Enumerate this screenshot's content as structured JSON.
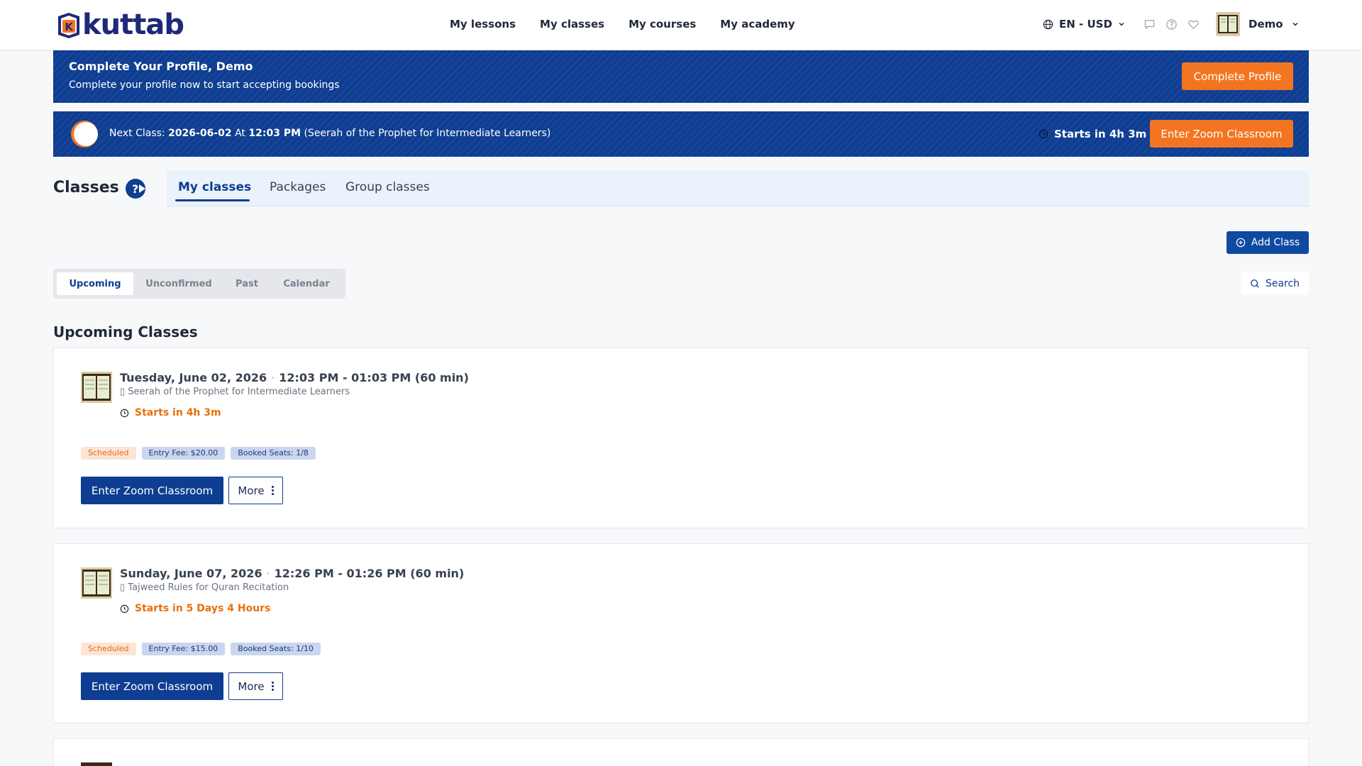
{
  "nav": {
    "logo_text": "kuttab",
    "links": [
      {
        "label": "My lessons"
      },
      {
        "label": "My classes"
      },
      {
        "label": "My courses"
      },
      {
        "label": "My academy"
      }
    ],
    "lang_currency": "EN - USD",
    "user_name": "Demo",
    "icons": [
      "chat-icon",
      "help-icon",
      "heart-icon"
    ]
  },
  "profile_banner": {
    "title": "Complete Your Profile, Demo",
    "subtitle": "Complete your profile now to start accepting bookings",
    "button": "Complete Profile"
  },
  "next_class_banner": {
    "prefix": "Next Class:",
    "date": "2026-06-02",
    "at": "At",
    "time": "12:03 PM",
    "course": "(Seerah of the Prophet for Intermediate Learners)",
    "starts_in": "Starts in 4h 3m",
    "button": "Enter Zoom Classroom"
  },
  "page": {
    "title": "Classes",
    "tabs": [
      {
        "label": "My classes",
        "active": true
      },
      {
        "label": "Packages",
        "active": false
      },
      {
        "label": "Group classes",
        "active": false
      }
    ],
    "add_button": "Add Class",
    "filters": [
      {
        "label": "Upcoming",
        "active": true
      },
      {
        "label": "Unconfirmed",
        "active": false
      },
      {
        "label": "Past",
        "active": false
      },
      {
        "label": "Calendar",
        "active": false
      }
    ],
    "search_button": "Search",
    "section_title": "Upcoming Classes"
  },
  "classes": [
    {
      "date": "Tuesday, June 02, 2026",
      "time": "12:03 PM - 01:03 PM (60 min)",
      "course": "Seerah of the Prophet for Intermediate Learners",
      "starts_in": "Starts in 4h 3m",
      "status": "Scheduled",
      "entry_fee": "Entry Fee: $20.00",
      "booked_seats": "Booked Seats: 1/8",
      "enter_button": "Enter Zoom Classroom",
      "more_button": "More"
    },
    {
      "date": "Sunday, June 07, 2026",
      "time": "12:26 PM - 01:26 PM (60 min)",
      "course": "Tajweed Rules for Quran Recitation",
      "starts_in": "Starts in 5 Days 4 Hours",
      "status": "Scheduled",
      "entry_fee": "Entry Fee: $15.00",
      "booked_seats": "Booked Seats: 1/10",
      "enter_button": "Enter Zoom Classroom",
      "more_button": "More"
    }
  ],
  "colors": {
    "brand_blue": "#0e3d91",
    "accent_orange": "#f47521",
    "starts_orange": "#e8710a"
  }
}
